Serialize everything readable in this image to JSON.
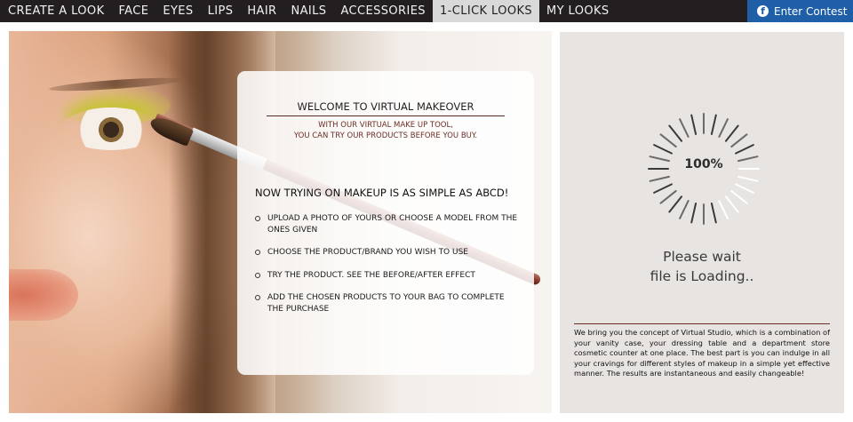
{
  "nav": {
    "items": [
      {
        "label": "CREATE A LOOK",
        "active": false
      },
      {
        "label": "FACE",
        "active": false
      },
      {
        "label": "EYES",
        "active": false
      },
      {
        "label": "LIPS",
        "active": false
      },
      {
        "label": "HAIR",
        "active": false
      },
      {
        "label": "NAILS",
        "active": false
      },
      {
        "label": "ACCESSORIES",
        "active": false
      },
      {
        "label": "1-CLICK LOOKS",
        "active": true
      },
      {
        "label": "MY LOOKS",
        "active": false
      }
    ],
    "contest": {
      "icon": "facebook-icon",
      "glyph": "f",
      "label": "Enter Contest"
    }
  },
  "welcome": {
    "title": "WELCOME TO VIRTUAL MAKEOVER",
    "subtitle_line1": "WITH OUR VIRTUAL MAKE UP TOOL,",
    "subtitle_line2": "YOU CAN TRY OUR PRODUCTS BEFORE YOU BUY.",
    "heading": "NOW TRYING ON MAKEUP IS AS SIMPLE AS ABCD!",
    "steps": [
      "UPLOAD A PHOTO OF YOURS OR CHOOSE A MODEL FROM THE ONES GIVEN",
      "CHOOSE THE PRODUCT/BRAND YOU WISH TO USE",
      "TRY THE PRODUCT. SEE THE BEFORE/AFTER EFFECT",
      "ADD THE CHOSEN PRODUCTS TO YOUR BAG TO COMPLETE THE PURCHASE"
    ]
  },
  "loader": {
    "progress": "100%",
    "progress_fraction": 1.0,
    "wait_line1": "Please wait",
    "wait_line2": "file is Loading..",
    "about": "We bring you the concept of Virtual Studio, which is a combination of your vanity case, your dressing table and a department store cosmetic counter at one place. The best part is you can indulge in all your cravings for different styles of makeup in a simple yet effective manner. The results are instantaneous and easily changeable!"
  },
  "colors": {
    "nav_bg": "#231f20",
    "nav_active_bg": "#d9d9d9",
    "contest_bg": "#1e5fa8",
    "accent": "#6b2d24",
    "loader_bg": "#e8e4e1"
  }
}
